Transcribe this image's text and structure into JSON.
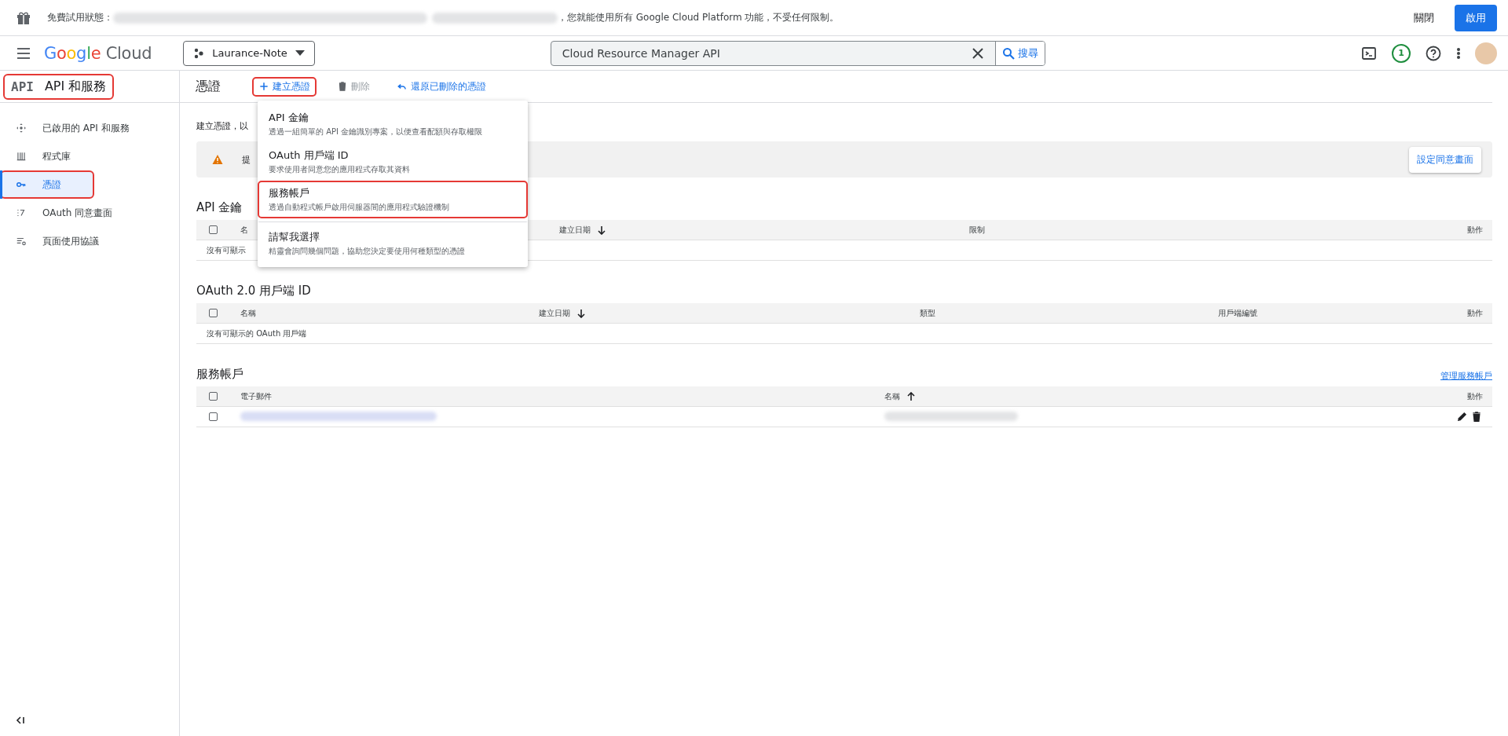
{
  "trial_banner": {
    "prefix": "免費試用狀態：",
    "suffix": "，您就能使用所有 Google Cloud Platform 功能，不受任何限制。",
    "dismiss": "關閉",
    "activate": "啟用"
  },
  "header": {
    "brand_google": "Google",
    "brand_cloud": "Cloud",
    "project": "Laurance-Note",
    "search_value": "Cloud Resource Manager API",
    "search_button": "搜尋",
    "notifications": "1"
  },
  "sidebar": {
    "logo": "API",
    "title": "API 和服務",
    "title_highlighted": true,
    "items": [
      {
        "label": "已啟用的 API 和服務",
        "selected": false,
        "highlighted": false
      },
      {
        "label": "程式庫",
        "selected": false,
        "highlighted": false
      },
      {
        "label": "憑證",
        "selected": true,
        "highlighted": true
      },
      {
        "label": "OAuth 同意畫面",
        "selected": false,
        "highlighted": false
      },
      {
        "label": "頁面使用協議",
        "selected": false,
        "highlighted": false
      }
    ]
  },
  "page": {
    "title": "憑證",
    "actions": [
      {
        "label": "建立憑證",
        "kind": "create",
        "disabled": false,
        "highlighted": true
      },
      {
        "label": "刪除",
        "kind": "delete",
        "disabled": true,
        "highlighted": false
      },
      {
        "label": "還原已刪除的憑證",
        "kind": "restore",
        "disabled": false,
        "highlighted": false
      }
    ],
    "intro": "建立憑證，以",
    "notice": {
      "text": "提",
      "button": "設定同意畫面"
    },
    "sections": [
      {
        "title": "API 金鑰",
        "all_checked": false,
        "columns": [
          {
            "label": "名"
          },
          {
            "label": "建立日期",
            "sort_ascending": false
          },
          {
            "label": "限制"
          },
          {
            "label": "動作"
          }
        ],
        "empty": "沒有可顯示"
      },
      {
        "title": "OAuth 2.0 用戶端 ID",
        "all_checked": false,
        "columns": [
          {
            "label": "名稱"
          },
          {
            "label": "建立日期",
            "sort_ascending": false
          },
          {
            "label": "類型"
          },
          {
            "label": "用戶端編號"
          },
          {
            "label": "動作"
          }
        ],
        "empty": "沒有可顯示的 OAuth 用戶端"
      },
      {
        "title": "服務帳戶",
        "link": "管理服務帳戶",
        "all_checked": false,
        "columns": [
          {
            "label": "電子郵件"
          },
          {
            "label": "名稱",
            "sort_ascending": true
          },
          {
            "label": "動作"
          }
        ],
        "rows": [
          {
            "checked": false
          }
        ]
      }
    ]
  },
  "create_menu": {
    "items": [
      {
        "title": "API 金鑰",
        "description": "透過一組簡單的 API 金鑰識別專案，以便查看配額與存取權限",
        "highlighted": false
      },
      {
        "title": "OAuth 用戶端 ID",
        "description": "要求使用者同意您的應用程式存取其資料",
        "highlighted": false
      },
      {
        "title": "服務帳戶",
        "description": "透過自動程式帳戶啟用伺服器間的應用程式驗證機制",
        "highlighted": true
      },
      {
        "title": "請幫我選擇",
        "description": "精靈會詢問幾個問題，協助您決定要使用何種類型的憑證",
        "highlighted": false
      }
    ]
  }
}
